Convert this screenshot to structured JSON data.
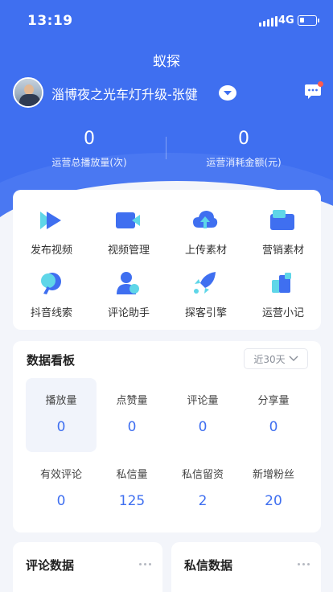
{
  "status": {
    "time": "13:19",
    "network": "4G"
  },
  "app": {
    "title": "蚁探"
  },
  "account": {
    "name": "淄博夜之光车灯升级-张健"
  },
  "summary": [
    {
      "value": "0",
      "label": "运营总播放量(次)"
    },
    {
      "value": "0",
      "label": "运营消耗金额(元)"
    }
  ],
  "tools": [
    {
      "label": "发布视频",
      "icon": "play-icon"
    },
    {
      "label": "视频管理",
      "icon": "video-camera-icon"
    },
    {
      "label": "上传素材",
      "icon": "cloud-upload-icon"
    },
    {
      "label": "营销素材",
      "icon": "folder-icon"
    },
    {
      "label": "抖音线索",
      "icon": "search-icon"
    },
    {
      "label": "评论助手",
      "icon": "user-icon"
    },
    {
      "label": "探客引擎",
      "icon": "rocket-icon"
    },
    {
      "label": "运营小记",
      "icon": "notes-icon"
    }
  ],
  "board": {
    "title": "数据看板",
    "range": "近30天",
    "metrics": [
      {
        "label": "播放量",
        "value": "0"
      },
      {
        "label": "点赞量",
        "value": "0"
      },
      {
        "label": "评论量",
        "value": "0"
      },
      {
        "label": "分享量",
        "value": "0"
      },
      {
        "label": "有效评论",
        "value": "0"
      },
      {
        "label": "私信量",
        "value": "125"
      },
      {
        "label": "私信留资",
        "value": "2"
      },
      {
        "label": "新增粉丝",
        "value": "20"
      }
    ]
  },
  "sections": {
    "comments_title": "评论数据",
    "messages_title": "私信数据"
  },
  "colors": {
    "primary": "#3f6ff0",
    "accent_cyan": "#5fd6e8",
    "badge": "#ff5a4e"
  }
}
